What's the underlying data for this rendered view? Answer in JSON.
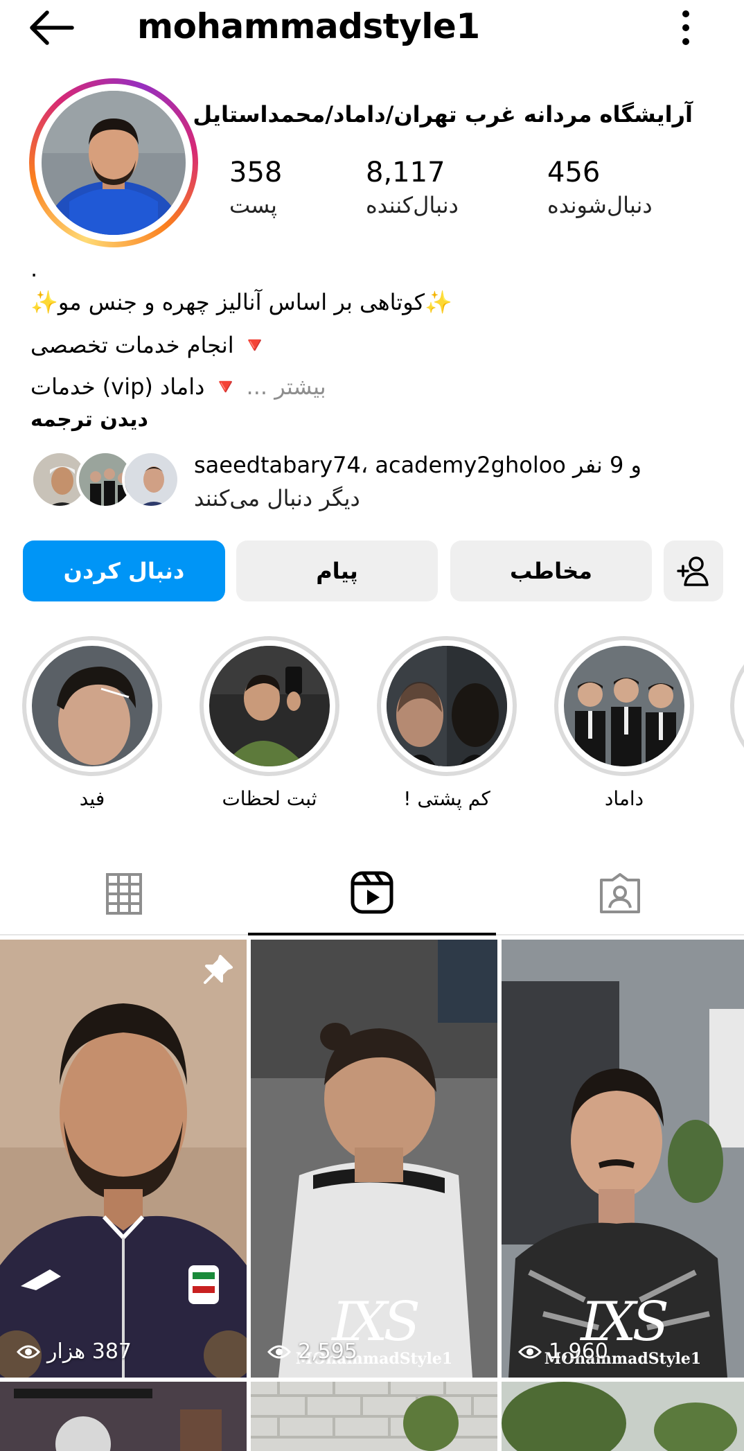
{
  "header": {
    "username": "mohammadstyle1"
  },
  "profile": {
    "full_name": "آرایشگاه مردانه غرب تهران/داماد/محمداستایل",
    "stats": [
      {
        "value": "358",
        "label": "پست"
      },
      {
        "value": "8,117",
        "label": "دنبال‌کننده"
      },
      {
        "value": "456",
        "label": "دنبال‌شونده"
      }
    ],
    "bio": {
      "line0": ".",
      "line1": "✨کوتاهی بر اساس آنالیز چهره و جنس مو✨",
      "line2": "🔻 انجام خدمات تخصصی",
      "line3_a": "خدمات (vip)",
      "line3_more": " بیشتر ...",
      "line3_b": " 🔻 داماد",
      "see_translation": "دیدن ترجمه"
    },
    "followed_by": {
      "line1_names": "saeedtabary74، academy2gholoo",
      "line1_suffix": "و 9 نفر",
      "line2": "دیگر دنبال می‌کنند"
    }
  },
  "actions": {
    "follow_label": "دنبال کردن",
    "message_label": "پیام",
    "contact_label": "مخاطب"
  },
  "highlights": [
    {
      "label": "فید"
    },
    {
      "label": "ثبت لحظات"
    },
    {
      "label": "کم پشتی !"
    },
    {
      "label": "داماد"
    }
  ],
  "tabs": [
    "grid-icon",
    "reels-icon",
    "tagged-icon"
  ],
  "reels": [
    {
      "views": "387 هزار",
      "pinned": true
    },
    {
      "views": "2,595",
      "watermark_brand": "MOhammadStyle1"
    },
    {
      "views": "1,960",
      "watermark_brand": "MOhammadStyle1"
    }
  ],
  "colors": {
    "accent_blue": "#0095f6",
    "button_gray": "#efefef",
    "story_ring_gray": "#dbdbdb"
  }
}
